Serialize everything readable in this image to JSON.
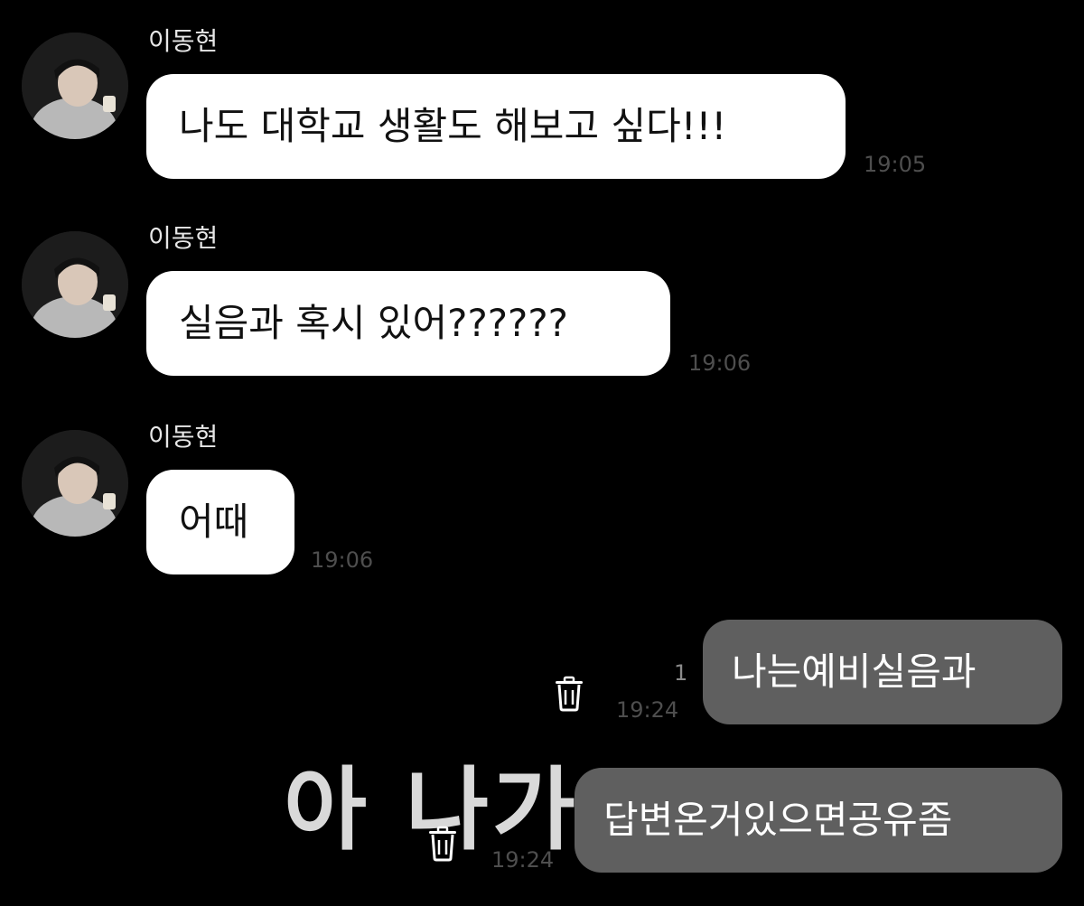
{
  "messages": [
    {
      "sender": "이동현",
      "text": "나도 대학교 생활도 해보고 싶다!!!",
      "time": "19:05"
    },
    {
      "sender": "이동현",
      "text": "실음과 혹시 있어??????",
      "time": "19:06"
    },
    {
      "sender": "이동현",
      "text": "어때",
      "time": "19:06"
    },
    {
      "text": "나는예비실음과",
      "time": "19:24",
      "unread": "1"
    },
    {
      "text": "답변온거있으면공유좀",
      "time": "19:24"
    }
  ],
  "overlay_caption": "아 나가",
  "icons": {
    "avatar": "profile-photo",
    "delete": "trash-icon"
  },
  "colors": {
    "background": "#000000",
    "incoming_bubble": "#ffffff",
    "outgoing_bubble": "#5f5f5f",
    "timestamp": "#4e4e4e"
  }
}
